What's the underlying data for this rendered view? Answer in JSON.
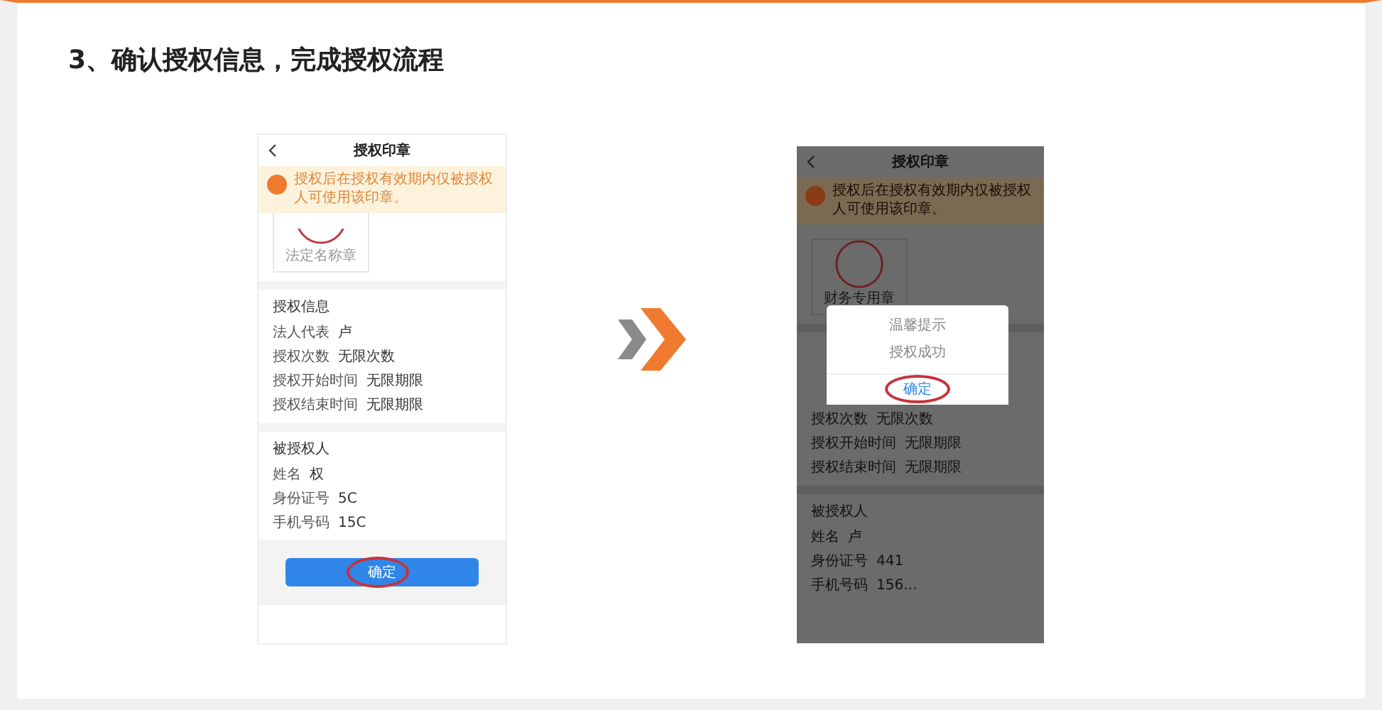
{
  "heading": "3、确认授权信息，完成授权流程",
  "phones": [
    {
      "dimmed": false,
      "title": "授权印章",
      "notice": "授权后在授权有效期内仅被授权人可使用该印章。",
      "seal_label": "法定名称章",
      "info": {
        "title": "授权信息",
        "rows": [
          {
            "label": "法人代表",
            "value": "卢"
          },
          {
            "label": "授权次数",
            "value": "无限次数"
          },
          {
            "label": "授权开始时间",
            "value": "无限期限"
          },
          {
            "label": "授权结束时间",
            "value": "无限期限"
          }
        ]
      },
      "grantee": {
        "title": "被授权人",
        "rows": [
          {
            "label": "姓名",
            "value": "权"
          },
          {
            "label": "身份证号",
            "value": "5C"
          },
          {
            "label": "手机号码",
            "value": "15C"
          }
        ]
      },
      "confirm_button": {
        "label": "确定",
        "highlighted": true
      }
    },
    {
      "dimmed": true,
      "title": "授权印章",
      "notice": "授权后在授权有效期内仅被授权人可使用该印章。",
      "seal_label": "财务专用章",
      "info": {
        "rows": [
          {
            "label": "授权次数",
            "value": "无限次数"
          },
          {
            "label": "授权开始时间",
            "value": "无限期限"
          },
          {
            "label": "授权结束时间",
            "value": "无限期限"
          }
        ]
      },
      "grantee": {
        "title": "被授权人",
        "rows": [
          {
            "label": "姓名",
            "value": "卢"
          },
          {
            "label": "身份证号",
            "value": "441"
          },
          {
            "label": "手机号码",
            "value": "156..."
          }
        ]
      },
      "dialog": {
        "title": "温馨提示",
        "message": "授权成功",
        "button": {
          "label": "确定",
          "highlighted": true
        }
      }
    }
  ]
}
